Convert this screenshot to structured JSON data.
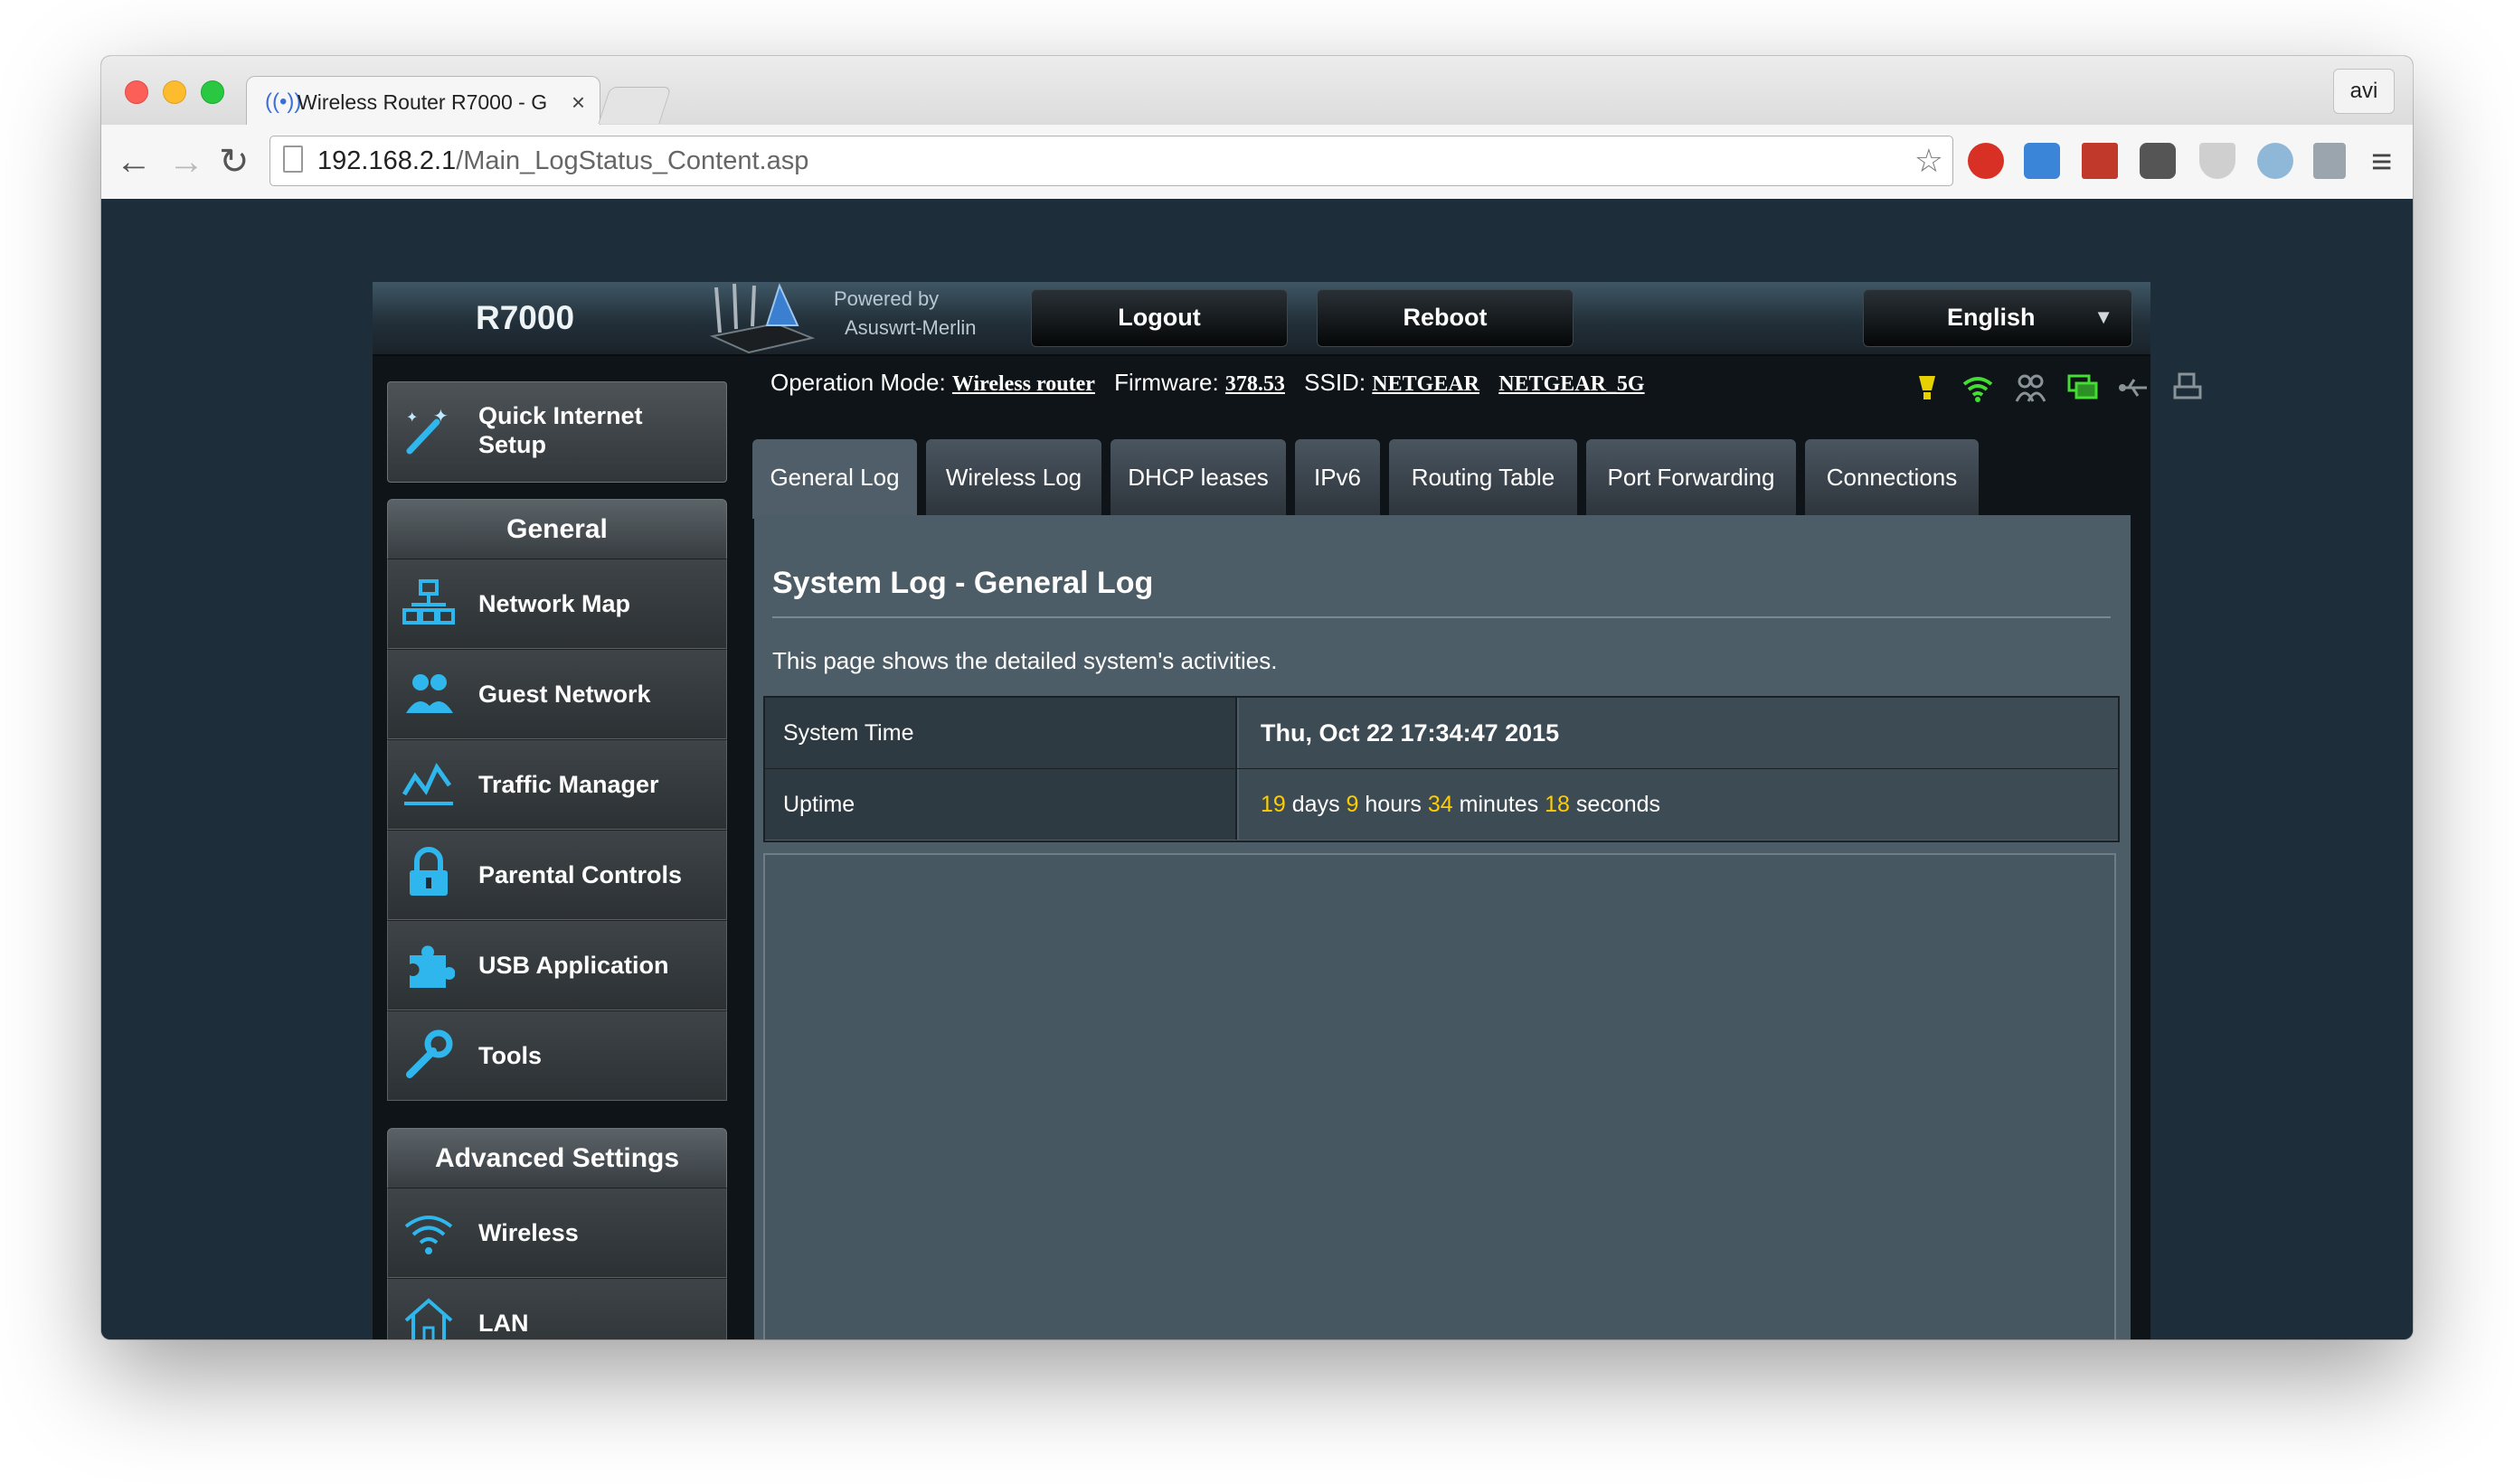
{
  "browser": {
    "tab_title": "Wireless Router R7000 - G",
    "tab_close": "×",
    "profile_name": "avi",
    "url_host": "192.168.2.1",
    "url_path": "/Main_LogStatus_Content.asp",
    "icons": {
      "back": "arrow-left",
      "forward": "arrow-right",
      "reload": "reload",
      "bookmark": "star",
      "menu": "hamburger"
    }
  },
  "header": {
    "model": "R7000",
    "powered_by_line1": "Powered by",
    "powered_by_line2": "Asuswrt-Merlin",
    "logout_label": "Logout",
    "reboot_label": "Reboot",
    "language_label": "English"
  },
  "sidebar": {
    "quick_setup_line1": "Quick Internet",
    "quick_setup_line2": "Setup",
    "general_header": "General",
    "general_items": [
      {
        "label": "Network Map",
        "icon": "network-map-icon"
      },
      {
        "label": "Guest Network",
        "icon": "guest-network-icon"
      },
      {
        "label": "Traffic Manager",
        "icon": "traffic-manager-icon"
      },
      {
        "label": "Parental Controls",
        "icon": "lock-icon"
      },
      {
        "label": "USB Application",
        "icon": "puzzle-icon"
      },
      {
        "label": "Tools",
        "icon": "wrench-icon"
      }
    ],
    "advanced_header": "Advanced Settings",
    "advanced_items": [
      {
        "label": "Wireless",
        "icon": "wifi-icon"
      },
      {
        "label": "LAN",
        "icon": "home-icon"
      }
    ]
  },
  "status_bar": {
    "operation_mode_label": "Operation Mode:",
    "operation_mode_value": "Wireless router",
    "firmware_label": "Firmware:",
    "firmware_value": "378.53",
    "ssid_label": "SSID:",
    "ssid_values": [
      "NETGEAR",
      "NETGEAR_5G"
    ],
    "status_icons": [
      "bulb-icon",
      "wifi-status-icon",
      "clients-icon",
      "monitor-icon",
      "usb-icon",
      "printer-icon"
    ]
  },
  "tabs": [
    {
      "label": "General Log",
      "active": true
    },
    {
      "label": "Wireless Log",
      "active": false
    },
    {
      "label": "DHCP leases",
      "active": false
    },
    {
      "label": "IPv6",
      "active": false
    },
    {
      "label": "Routing Table",
      "active": false
    },
    {
      "label": "Port Forwarding",
      "active": false
    },
    {
      "label": "Connections",
      "active": false
    }
  ],
  "main": {
    "title": "System Log - General Log",
    "description": "This page shows the detailed system's activities.",
    "system_time_label": "System Time",
    "system_time_value": "Thu, Oct 22 17:34:47 2015",
    "uptime_label": "Uptime",
    "uptime": {
      "days": "19",
      "days_word": "days",
      "hours": "9",
      "hours_word": "hours",
      "minutes": "34",
      "minutes_word": "minutes",
      "seconds": "18",
      "seconds_word": "seconds"
    },
    "log_text": ""
  },
  "colors": {
    "accent_yellow": "#ffcc00",
    "icon_blue": "#2fb6ec",
    "status_green": "#44dd33",
    "content_bg": "#4d5d67"
  }
}
